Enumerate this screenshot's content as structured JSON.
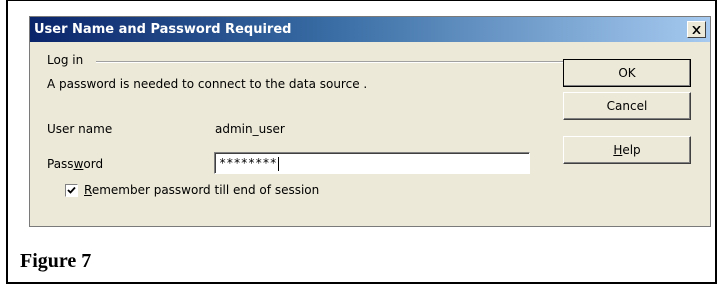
{
  "dialog": {
    "title": "User Name and Password Required",
    "close_icon": "close-icon",
    "group_label": "Log in",
    "message": "A password is needed to connect to the data source .",
    "username_label": "User name",
    "username_value": "admin_user",
    "password_label_pre": "Pass",
    "password_label_underlined": "w",
    "password_label_post": "ord",
    "password_value": "********",
    "remember_checked": true,
    "remember_underlined": "R",
    "remember_rest": "emember password till end of session",
    "buttons": {
      "ok": "OK",
      "cancel": "Cancel",
      "help_underlined": "H",
      "help_rest": "elp"
    }
  },
  "caption": "Figure 7",
  "colors": {
    "titlebar_start": "#0a246a",
    "titlebar_end": "#a6caf0",
    "dialog_bg": "#ece9d8"
  }
}
